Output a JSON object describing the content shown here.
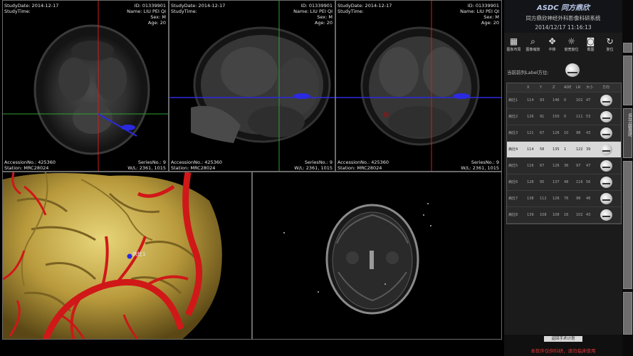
{
  "study": {
    "date_label": "StudyDate: 2014-12-17",
    "time_label": "StudyTime:",
    "id_label": "ID: 01339901",
    "name_label": "Name: LIU PEI QI",
    "sex_label": "Sex: M",
    "age_label": "Age: 20",
    "accession_label": "AccessionNo.: 425360",
    "station_label": "Station: MRC28024",
    "series_label": "SeriesNo.: 9",
    "wl_label": "W/L: 2361, 1015"
  },
  "header": {
    "logo": "ASDC 同方鼎欣",
    "system_name": "同方鼎欣神经外科影像科研系统",
    "datetime": "2014/12/17 11:16:13"
  },
  "toolbar": {
    "items": [
      {
        "icon": "image-layout-icon",
        "glyph": "▦",
        "label": "图象布局"
      },
      {
        "icon": "magnifier-icon",
        "glyph": "⌕",
        "label": "图像缩放"
      },
      {
        "icon": "pan-icon",
        "glyph": "✥",
        "label": "平移"
      },
      {
        "icon": "window-level-icon",
        "glyph": "☼",
        "label": "窗宽窗位"
      },
      {
        "icon": "camera-icon",
        "glyph": "◙",
        "label": "截图"
      },
      {
        "icon": "reset-icon",
        "glyph": "↻",
        "label": "复位"
      }
    ]
  },
  "orientation_label": "当前前列Label方位:",
  "table": {
    "headers": [
      "",
      "X",
      "Y",
      "Z",
      "ADE",
      "LR",
      "大小",
      "方向"
    ],
    "rows": [
      {
        "name": "病灶1",
        "vals": [
          "114",
          "93",
          "146",
          "0",
          "102",
          "47"
        ],
        "selected": false
      },
      {
        "name": "病灶2",
        "vals": [
          "126",
          "91",
          "150",
          "0",
          "111",
          "53"
        ],
        "selected": false
      },
      {
        "name": "病灶3",
        "vals": [
          "121",
          "67",
          "126",
          "10",
          "98",
          "43"
        ],
        "selected": false
      },
      {
        "name": "病灶4",
        "vals": [
          "114",
          "58",
          "135",
          "1",
          "122",
          "39"
        ],
        "selected": true
      },
      {
        "name": "病灶5",
        "vals": [
          "116",
          "67",
          "126",
          "36",
          "97",
          "47"
        ],
        "selected": false
      },
      {
        "name": "病灶6",
        "vals": [
          "128",
          "95",
          "137",
          "48",
          "116",
          "56"
        ],
        "selected": false
      },
      {
        "name": "病灶7",
        "vals": [
          "138",
          "112",
          "126",
          "76",
          "98",
          "48"
        ],
        "selected": false
      },
      {
        "name": "病灶8",
        "vals": [
          "139",
          "108",
          "108",
          "16",
          "102",
          "43"
        ],
        "selected": false
      }
    ]
  },
  "annotation_3d": "病灶1",
  "bottom": {
    "plan_button": "返回手术计划",
    "warning": "本软件仅供科研，请勿临床使用"
  },
  "side_tabs": [
    "多平面重建"
  ],
  "colors": {
    "crosshair_red": "#d01c1c",
    "crosshair_green": "#2fa02f",
    "marker_blue": "#2a2ae0",
    "panel_bg": "#1b1b1b"
  }
}
